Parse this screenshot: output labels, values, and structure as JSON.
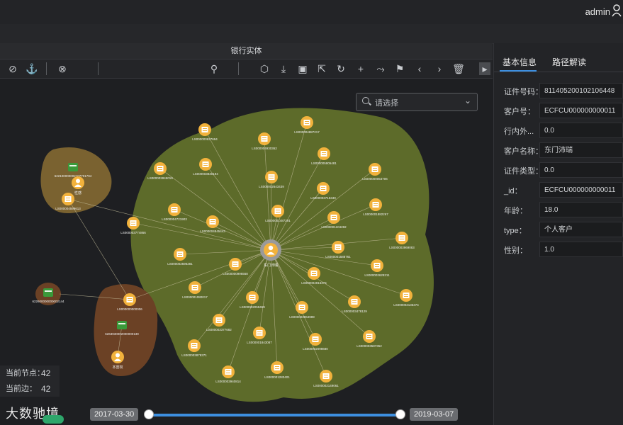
{
  "header": {
    "user": "admin"
  },
  "main": {
    "title": "银行实体"
  },
  "search": {
    "placeholder": "请选择"
  },
  "stats": {
    "nodes_label": "当前节点：",
    "nodes_value": "42",
    "edges_label": "当前边：",
    "edges_value": "42"
  },
  "timeline": {
    "start": "2017-03-30",
    "end": "2019-03-07"
  },
  "brand": {
    "text": "大数驰境"
  },
  "panel": {
    "tabs": [
      "基本信息",
      "路径解读"
    ],
    "props": [
      {
        "label": "证件号码：",
        "value": "811405200102106448"
      },
      {
        "label": "客户号：",
        "value": "ECFCU000000000011"
      },
      {
        "label": "行内外...",
        "value": "0.0"
      },
      {
        "label": "客户名称：",
        "value": "东门沛瑞"
      },
      {
        "label": "证件类型：",
        "value": "0.0"
      },
      {
        "label": "_id：",
        "value": "ECFCU000000000011"
      },
      {
        "label": "年龄：",
        "value": "18.0"
      },
      {
        "label": "type：",
        "value": "个人客户"
      },
      {
        "label": "性别：",
        "value": "1.0"
      }
    ]
  },
  "graph": {
    "center_label": "东门沛瑞",
    "colors": {
      "cluster_main": "#5d6b2a",
      "cluster_small": "#7a6230",
      "cluster_brown": "#6b4125",
      "node": "#f2b23c",
      "card": "#3a9a3a"
    },
    "nodes": [
      {
        "label": "LS000000627694"
      },
      {
        "label": "LS000004930362"
      },
      {
        "label": "LS000004887217"
      },
      {
        "label": "LS000003830194"
      },
      {
        "label": "LS000002845019"
      },
      {
        "label": "LS000005905481"
      },
      {
        "label": "LS000002643439"
      },
      {
        "label": "LS000003715340"
      },
      {
        "label": "LS000000054706"
      },
      {
        "label": "LS000004721903"
      },
      {
        "label": "LS000001487291"
      },
      {
        "label": "LS000004845443"
      },
      {
        "label": "LS000003774866"
      },
      {
        "label": "LS000001104282"
      },
      {
        "label": "LS000001882267"
      },
      {
        "label": "LS000002596281"
      },
      {
        "label": "LS000000996568"
      },
      {
        "label": "LS000001588761"
      },
      {
        "label": "LS000003969083"
      },
      {
        "label": "LS000002628211"
      },
      {
        "label": "LS000004916374"
      },
      {
        "label": "LS000001080017"
      },
      {
        "label": "LS000002059459"
      },
      {
        "label": "LS000003478129"
      },
      {
        "label": "LS000002135374"
      },
      {
        "label": "LS000003377682"
      },
      {
        "label": "LS000003964989"
      },
      {
        "label": "LS000001843087"
      },
      {
        "label": "LS000002098680"
      },
      {
        "label": "LS000003587352"
      },
      {
        "label": "LS000003878371"
      },
      {
        "label": "LS000003940814"
      },
      {
        "label": "LS000001283401"
      },
      {
        "label": "LS000002149061"
      }
    ],
    "left_cluster": {
      "card_label": "622100000002107701794",
      "person_label": "性感",
      "node_label": "LS000004599613"
    },
    "green_card_label": "622600000000002144",
    "brown_cluster": {
      "node_label": "LS000000000006",
      "card_label": "6263930002000000139",
      "person_label": "本雷权"
    }
  }
}
